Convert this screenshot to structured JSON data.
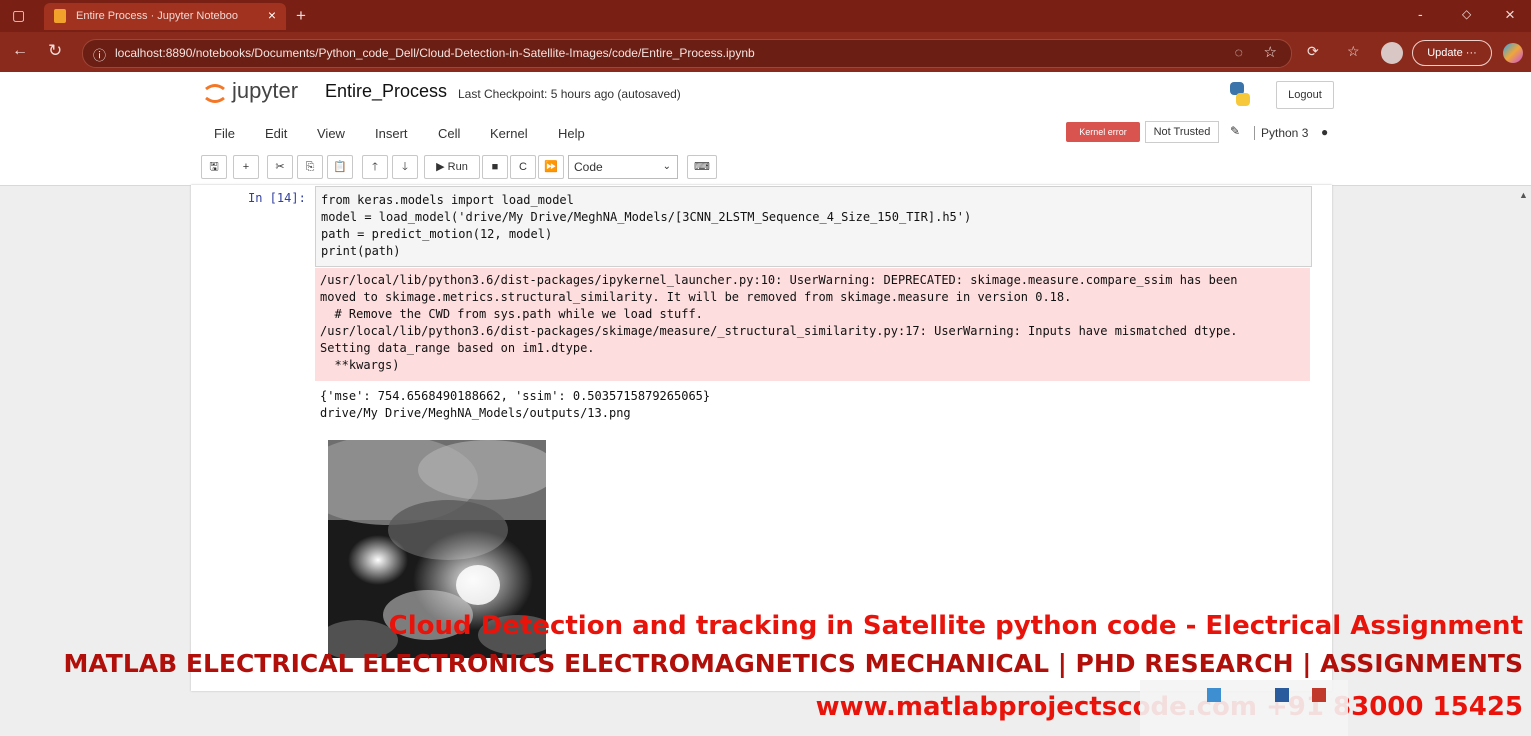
{
  "browser": {
    "tab_title": "Entire Process · Jupyter Noteboo",
    "tab_close": "×",
    "new_tab": "+",
    "url": "localhost:8890/notebooks/Documents/Python_code_Dell/Cloud-Detection-in-Satellite-Images/code/Entire_Process.ipynb",
    "update_label": "Update",
    "window_min": "-",
    "window_max": "◇",
    "window_close": "×"
  },
  "jupyter": {
    "logo_text": "jupyter",
    "notebook_name": "Entire_Process",
    "checkpoint": "Last Checkpoint: 5 hours ago  (autosaved)",
    "logout": "Logout"
  },
  "menu": {
    "items": [
      "File",
      "Edit",
      "View",
      "Insert",
      "Cell",
      "Kernel",
      "Help"
    ],
    "kernel_error": "Kernel error",
    "not_trusted": "Not Trusted",
    "kernel_name": "Python 3"
  },
  "toolbar": {
    "run_label": "Run",
    "cell_type": "Code"
  },
  "cell": {
    "prompt": "In [14]:",
    "code_lines": [
      "from keras.models import load_model",
      "model = load_model('drive/My Drive/MeghNA_Models/[3CNN_2LSTM_Sequence_4_Size_150_TIR].h5')",
      "path = predict_motion(12, model)",
      "print(path)"
    ],
    "stderr_lines": [
      "/usr/local/lib/python3.6/dist-packages/ipykernel_launcher.py:10: UserWarning: DEPRECATED: skimage.measure.compare_ssim has been",
      "moved to skimage.metrics.structural_similarity. It will be removed from skimage.measure in version 0.18.",
      "  # Remove the CWD from sys.path while we load stuff.",
      "/usr/local/lib/python3.6/dist-packages/skimage/measure/_structural_similarity.py:17: UserWarning: Inputs have mismatched dtype.",
      "Setting data_range based on im1.dtype.",
      "  **kwargs)"
    ],
    "stdout_lines": [
      "{'mse': 754.6568490188662, 'ssim': 0.5035715879265065}",
      "drive/My Drive/MeghNA_Models/outputs/13.png"
    ]
  },
  "watermark": {
    "line1": "Cloud Detection and tracking in Satellite python code - Electrical Assignment",
    "line2": "MATLAB ELECTRICAL ELECTRONICS ELECTROMAGNETICS MECHANICAL | PHD RESEARCH | ASSIGNMENTS",
    "line3": "www.matlabprojectscode.com +91 83000 15425"
  },
  "colors": {
    "chrome": "#7a1f14",
    "kernel_error": "#d9534f",
    "stderr_bg": "#fddddd",
    "watermark_red": "#e8140c",
    "watermark_dark": "#b10f0a"
  }
}
